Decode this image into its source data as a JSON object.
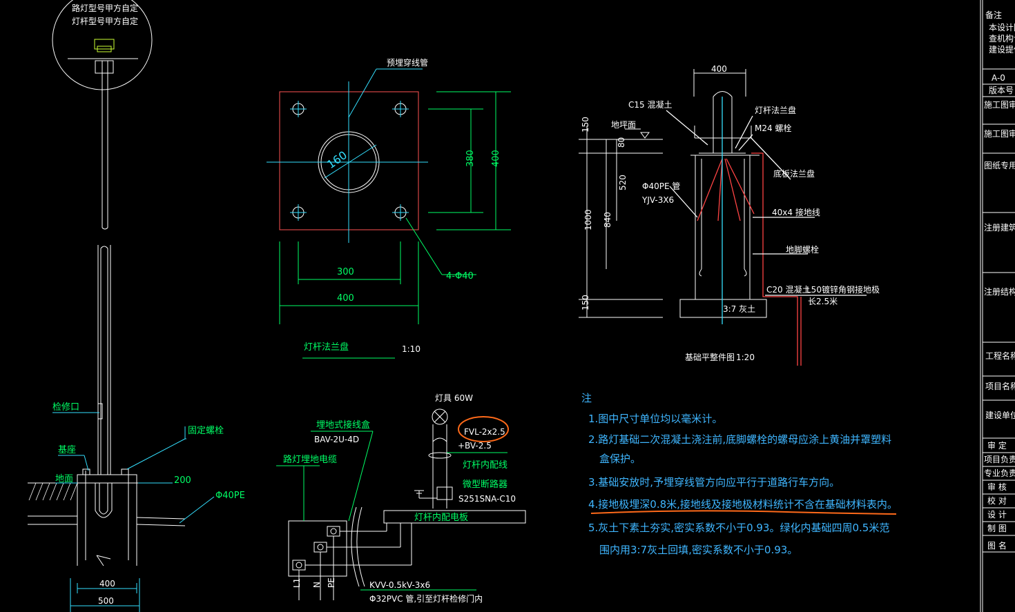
{
  "pole_detail": {
    "circle_text_1": "路灯型号甲方自定",
    "circle_text_2": "灯杆型号甲方自定",
    "inspection_port": "检修口",
    "fixing_bolt": "固定螺栓",
    "base": "基座",
    "ground": "地面",
    "dim_200": "200",
    "pipe_pe": "Φ40PE",
    "dim_400": "400",
    "dim_500": "500"
  },
  "flange": {
    "title": "灯杆法兰盘",
    "scale": "1:10",
    "conduit_label": "预埋穿线管",
    "dia_160": "160",
    "hole_label": "4-Φ40",
    "dim_300_h": "300",
    "dim_400_h": "400",
    "dim_380_v": "380",
    "dim_400_v": "400"
  },
  "foundation": {
    "title": "基础平整件图",
    "scale": "1:20",
    "dim_top_400": "400",
    "c15_label": "C15  混凝土",
    "ground_label": "地坪面",
    "pole_flange": "灯杆法兰盘",
    "m24": "M24  螺栓",
    "base_flange": "底板法兰盘",
    "pipe_label": "Φ40PE  管",
    "cable_label": "YJV-3X6",
    "ground_wire": "40x4  接地线",
    "anchor_bolt": "地脚螺栓",
    "c20_label": "C20  混凝土",
    "ground_rod": "L50镀锌角钢接地极",
    "rod_length": "长2.5米",
    "fill_label": "3:7  灰土",
    "d150a": "150",
    "d80": "80",
    "d520": "520",
    "d1000": "1000",
    "d840": "840",
    "d150b": "150"
  },
  "wiring": {
    "lamp": "灯具  60W",
    "fvl": "FVL-2x2.5",
    "bv": "+BV-2.5",
    "panel_in": "灯杆内配线",
    "breaker": "微型断路器",
    "breaker_model": "S251SNA-C10",
    "junction_box": "埋地式接线盒",
    "box_model": "BAV-2U-4D",
    "cable_label": "路灯埋地电缆",
    "panel": "灯杆内配电板",
    "kvv": "KVV-0.5kV-3x6",
    "pvc": "Φ32PVC  管,引至灯杆检修门内",
    "l1": "L1",
    "n": "N",
    "pe": "PE"
  },
  "notes": {
    "heading": "注",
    "n1": "1.图中尺寸单位均以毫米计。",
    "n2a": "2.路灯基础二次混凝土浇注前,底脚螺栓的螺母应涂上黄油并罩塑料",
    "n2b": "盒保护。",
    "n3": "3.基础安放时,予埋穿线管方向应平行于道路行车方向。",
    "n4": "4.接地极埋深0.8米,接地线及接地极材料统计不含在基础材料表内。",
    "n5a": "5.灰土下素土夯实,密实系数不小于0.93。绿化内基础四周0.5米范",
    "n5b": "围内用3:7灰土回填,密实系数不小于0.93。"
  },
  "title_block": {
    "remark": "备注",
    "r1": "本设计图纸",
    "r2": "查机构认可",
    "r3": "建设提供前",
    "version_code": "A-0",
    "version": "版本号",
    "approval1": "施工图审查",
    "approval2": "施工图审查合",
    "seal": "图纸专用章",
    "reg_arch": "注册建筑师",
    "reg_struct": "注册结构师",
    "project": "工程名称",
    "item": "项目名称",
    "unit": "建设单位",
    "review": "审    定",
    "leader": "项目负责人",
    "prof": "专业负责人",
    "check": "审    核",
    "proof": "校    对",
    "design": "设    计",
    "draw": "制    图",
    "drawing_name": "图    名"
  },
  "colors": {
    "background": "#000000",
    "line_white": "#ffffff",
    "line_green": "#00ff66",
    "line_cyan": "#34e0ff",
    "line_red": "#ff4444",
    "markup_orange": "#ff6a1a",
    "note_blue": "#3fb6ff"
  }
}
